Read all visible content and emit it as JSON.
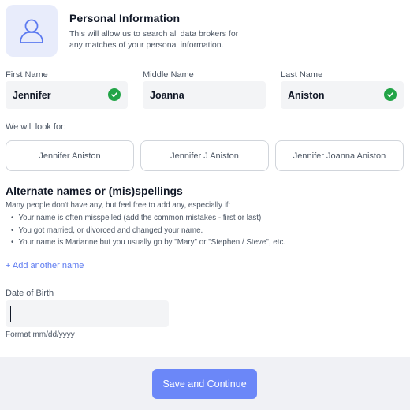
{
  "header": {
    "title": "Personal Information",
    "subtitle": "This will allow us to search all data brokers for any matches of your personal information.",
    "icon": "user-outline-icon"
  },
  "name_fields": {
    "first": {
      "label": "First Name",
      "value": "Jennifer",
      "verified": true
    },
    "middle": {
      "label": "Middle Name",
      "value": "Joanna",
      "verified": false
    },
    "last": {
      "label": "Last Name",
      "value": "Aniston",
      "verified": true
    }
  },
  "lookfor": {
    "label": "We will look for:",
    "variants": [
      "Jennifer Aniston",
      "Jennifer J Aniston",
      "Jennifer Joanna Aniston"
    ]
  },
  "alternate": {
    "title": "Alternate names or (mis)spellings",
    "intro": "Many people don't have any, but feel free to add any, especially if:",
    "bullets": [
      "Your name is often misspelled (add the common mistakes - first or last)",
      "You got married, or divorced and changed your name.",
      "Your name is Marianne but you usually go by \"Mary\" or \"Stephen / Steve\", etc."
    ],
    "add_link": "+ Add another name"
  },
  "dob": {
    "label": "Date of Birth",
    "value": "",
    "hint": "Format mm/dd/yyyy"
  },
  "footer": {
    "save_label": "Save and Continue"
  },
  "colors": {
    "accent": "#6b87f8",
    "link": "#5b79f0",
    "success": "#22a447",
    "icon_bg": "#e8ecfb"
  }
}
